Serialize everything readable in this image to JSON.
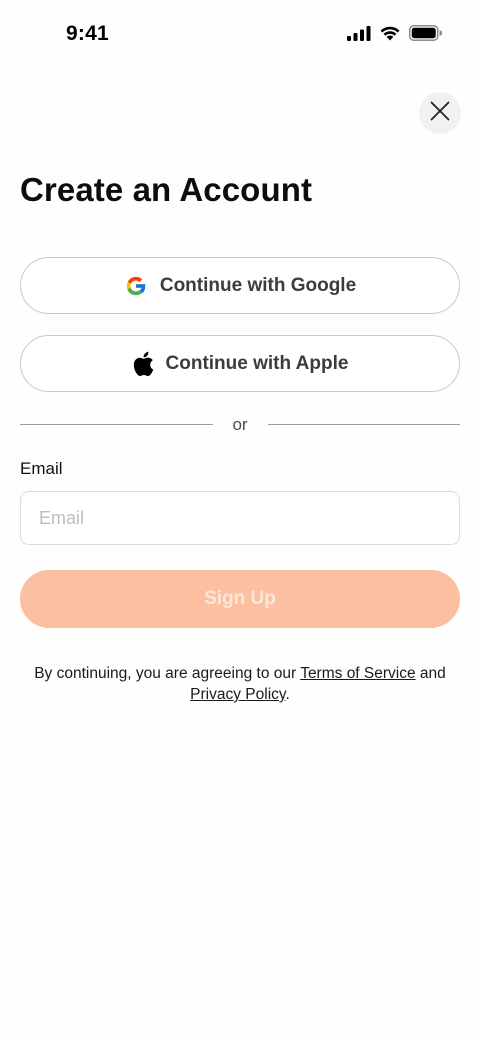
{
  "status_bar": {
    "time": "9:41"
  },
  "page": {
    "title": "Create an Account"
  },
  "social": {
    "google_label": "Continue with Google",
    "apple_label": "Continue with Apple"
  },
  "divider": {
    "text": "or"
  },
  "email": {
    "label": "Email",
    "placeholder": "Email",
    "value": ""
  },
  "signup": {
    "label": "Sign Up",
    "enabled": false
  },
  "legal": {
    "prefix": "By continuing, you are agreeing to our ",
    "terms_link": "Terms of Service",
    "middle": " and",
    "privacy_link": "Privacy Policy",
    "suffix": "."
  },
  "colors": {
    "accent_disabled": "#fdbfa1",
    "google_blue": "#4285F4",
    "google_red": "#EA4335",
    "google_yellow": "#FBBC05",
    "google_green": "#34A853"
  },
  "icons": [
    "cellular-signal-icon",
    "wifi-icon",
    "battery-icon",
    "close-icon",
    "google-logo-icon",
    "apple-logo-icon"
  ]
}
